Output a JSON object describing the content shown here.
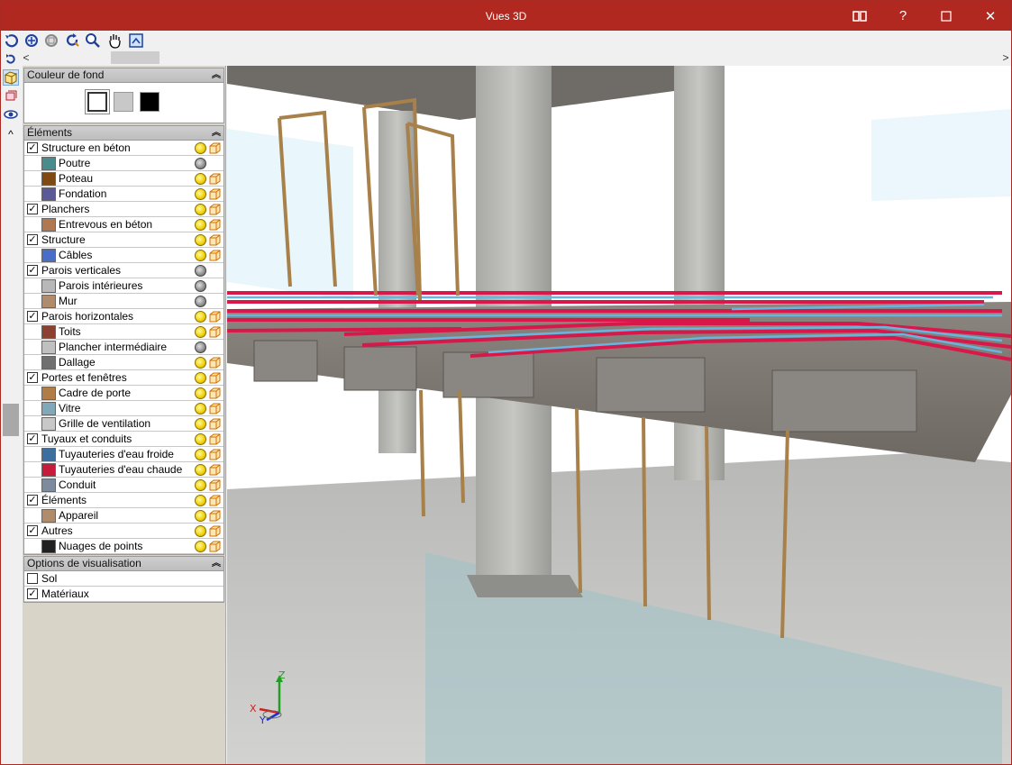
{
  "window": {
    "title": "Vues 3D",
    "buttons": [
      "book-icon",
      "help-icon",
      "maximize-icon",
      "close-icon"
    ],
    "help_glyph": "?",
    "max_glyph": "☐",
    "close_glyph": "✕"
  },
  "toolbar": {
    "tools": [
      "rotate-icon",
      "zoom-all-icon",
      "zoom-window-icon",
      "refresh-icon",
      "zoom-icon",
      "pan-hand-icon",
      "view-icon"
    ]
  },
  "scroll": {
    "left_arrow": "<",
    "right_arrow": ">"
  },
  "panel": {
    "background": {
      "title": "Couleur de fond",
      "options": [
        {
          "name": "white",
          "color": "#ffffff",
          "selected": true
        },
        {
          "name": "gray",
          "color": "#c8c8c8",
          "selected": false
        },
        {
          "name": "black",
          "color": "#000000",
          "selected": false
        }
      ]
    },
    "elements": {
      "title": "Éléments",
      "rows": [
        {
          "label": "Structure en béton",
          "type": "group",
          "checked": true,
          "state": "yellow"
        },
        {
          "label": "Poutre",
          "type": "item",
          "color": "#4a8c8c",
          "state": "gray"
        },
        {
          "label": "Poteau",
          "type": "item",
          "color": "#7f4a12",
          "state": "yellow"
        },
        {
          "label": "Fondation",
          "type": "item",
          "color": "#5a5a96",
          "state": "yellow"
        },
        {
          "label": "Planchers",
          "type": "group",
          "checked": true,
          "state": "yellow"
        },
        {
          "label": "Entrevous en béton",
          "type": "item",
          "color": "#b07850",
          "state": "yellow"
        },
        {
          "label": "Structure",
          "type": "group",
          "checked": true,
          "state": "yellow"
        },
        {
          "label": "Câbles",
          "type": "item",
          "color": "#4a6ec8",
          "state": "yellow"
        },
        {
          "label": "Parois verticales",
          "type": "group",
          "checked": true,
          "state": "gray"
        },
        {
          "label": "Parois intérieures",
          "type": "item",
          "color": "#b8b8b8",
          "state": "gray"
        },
        {
          "label": "Mur",
          "type": "item",
          "color": "#b08c6c",
          "state": "gray"
        },
        {
          "label": "Parois horizontales",
          "type": "group",
          "checked": true,
          "state": "yellow"
        },
        {
          "label": "Toits",
          "type": "item",
          "color": "#8c4030",
          "state": "yellow"
        },
        {
          "label": "Plancher intermédiaire",
          "type": "item",
          "color": "#c0c0c0",
          "state": "gray"
        },
        {
          "label": "Dallage",
          "type": "item",
          "color": "#707070",
          "state": "yellow"
        },
        {
          "label": "Portes et fenêtres",
          "type": "group",
          "checked": true,
          "state": "yellow"
        },
        {
          "label": "Cadre de porte",
          "type": "item",
          "color": "#b07c48",
          "state": "yellow"
        },
        {
          "label": "Vitre",
          "type": "item",
          "color": "#80a8b8",
          "state": "yellow"
        },
        {
          "label": "Grille de ventilation",
          "type": "item",
          "color": "#c8c8c8",
          "state": "yellow"
        },
        {
          "label": "Tuyaux et conduits",
          "type": "group",
          "checked": true,
          "state": "yellow"
        },
        {
          "label": "Tuyauteries d'eau froide",
          "type": "item",
          "color": "#3c6ea0",
          "state": "yellow"
        },
        {
          "label": "Tuyauteries d'eau chaude",
          "type": "item",
          "color": "#c81a3a",
          "state": "yellow"
        },
        {
          "label": "Conduit",
          "type": "item",
          "color": "#7c8c9c",
          "state": "yellow"
        },
        {
          "label": "Éléments",
          "type": "group",
          "checked": true,
          "state": "yellow"
        },
        {
          "label": "Appareil",
          "type": "item",
          "color": "#b08c6c",
          "state": "yellow"
        },
        {
          "label": "Autres",
          "type": "group",
          "checked": true,
          "state": "yellow"
        },
        {
          "label": "Nuages de points",
          "type": "item",
          "color": "#202020",
          "state": "yellow"
        }
      ]
    },
    "options": {
      "title": "Options de visualisation",
      "rows": [
        {
          "label": "Sol",
          "checked": false
        },
        {
          "label": "Matériaux",
          "checked": true
        }
      ]
    }
  },
  "viewport": {
    "axes": {
      "z": "Z",
      "x": "X",
      "y": "Y"
    },
    "colors": {
      "hot_pipe": "#d8184a",
      "cold_pipe": "#6ab4e0",
      "wood": "#a8804a",
      "concrete": "#b8b8b4",
      "floor": "#c8c8c6"
    }
  }
}
